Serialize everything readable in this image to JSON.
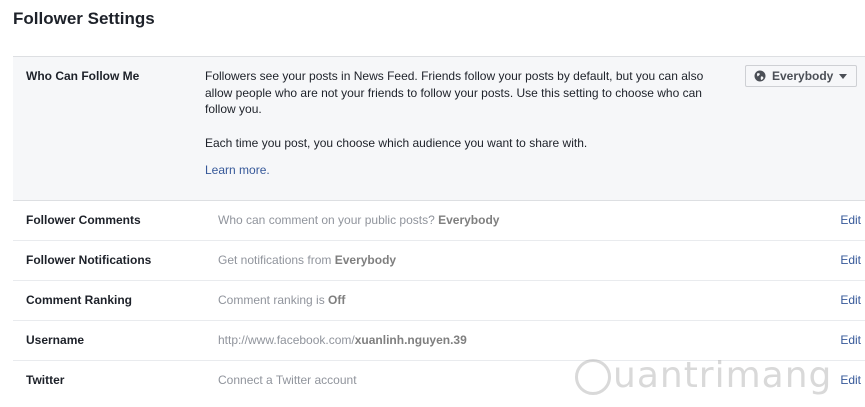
{
  "page": {
    "title": "Follower Settings"
  },
  "follow": {
    "label": "Who Can Follow Me",
    "desc1": "Followers see your posts in News Feed. Friends follow your posts by default, but you can also allow people who are not your friends to follow your posts. Use this setting to choose who can follow you.",
    "desc2": "Each time you post, you choose which audience you want to share with.",
    "learn_more": "Learn more.",
    "audience": {
      "value": "Everybody",
      "icon": "globe-icon"
    }
  },
  "rows": [
    {
      "label": "Follower Comments",
      "prefix": "Who can comment on your public posts? ",
      "value": "Everybody",
      "edit": "Edit"
    },
    {
      "label": "Follower Notifications",
      "prefix": "Get notifications from ",
      "value": "Everybody",
      "edit": "Edit"
    },
    {
      "label": "Comment Ranking",
      "prefix": "Comment ranking is ",
      "value": "Off",
      "edit": "Edit"
    },
    {
      "label": "Username",
      "prefix": "http://www.facebook.com/",
      "value": "xuanlinh.nguyen.39",
      "edit": "Edit"
    },
    {
      "label": "Twitter",
      "prefix": "Connect a Twitter account",
      "value": "",
      "edit": "Edit"
    }
  ],
  "watermark": {
    "text": "uantrimang"
  },
  "colors": {
    "link": "#365899",
    "section_bg": "#f6f7f9",
    "border": "#dddfe2",
    "muted": "#90949c"
  }
}
